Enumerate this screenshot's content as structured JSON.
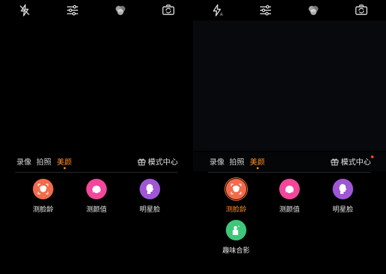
{
  "left_screen": {
    "topbar": {
      "flash": "flash-off-icon",
      "settings": "settings-sliders-icon",
      "filter": "filter-circles-icon",
      "switch_camera": "switch-camera-icon"
    },
    "tabs": [
      {
        "label": "录像",
        "active": false
      },
      {
        "label": "拍照",
        "active": false
      },
      {
        "label": "美颜",
        "active": true
      }
    ],
    "mode_center": {
      "label": "模式中心",
      "icon": "gift-icon",
      "badge": false
    },
    "effects": [
      {
        "label": "测脸龄",
        "color": "#f26b4b",
        "icon": "face-age-icon",
        "selected": false
      },
      {
        "label": "测颜值",
        "color": "#f2479a",
        "icon": "face-score-icon",
        "selected": false
      },
      {
        "label": "明星脸",
        "color": "#a057d6",
        "icon": "star-face-icon",
        "selected": false
      }
    ]
  },
  "right_screen": {
    "topbar": {
      "flash": "flash-auto-icon",
      "settings": "settings-sliders-icon",
      "filter": "filter-circles-icon",
      "switch_camera": "switch-camera-icon"
    },
    "tabs": [
      {
        "label": "录像",
        "active": false
      },
      {
        "label": "拍照",
        "active": false
      },
      {
        "label": "美颜",
        "active": true
      }
    ],
    "mode_center": {
      "label": "模式中心",
      "icon": "gift-icon",
      "badge": true
    },
    "effects": [
      {
        "label": "测脸龄",
        "color": "#f26b4b",
        "icon": "face-age-icon",
        "selected": true
      },
      {
        "label": "测颜值",
        "color": "#f2479a",
        "icon": "face-score-icon",
        "selected": false
      },
      {
        "label": "明星脸",
        "color": "#a057d6",
        "icon": "star-face-icon",
        "selected": false
      },
      {
        "label": "趣味合影",
        "color": "#3ec77a",
        "icon": "group-photo-icon",
        "selected": false
      }
    ]
  },
  "colors": {
    "accent": "#ff8a1f",
    "badge": "#ff3b30",
    "background": "#000000"
  }
}
